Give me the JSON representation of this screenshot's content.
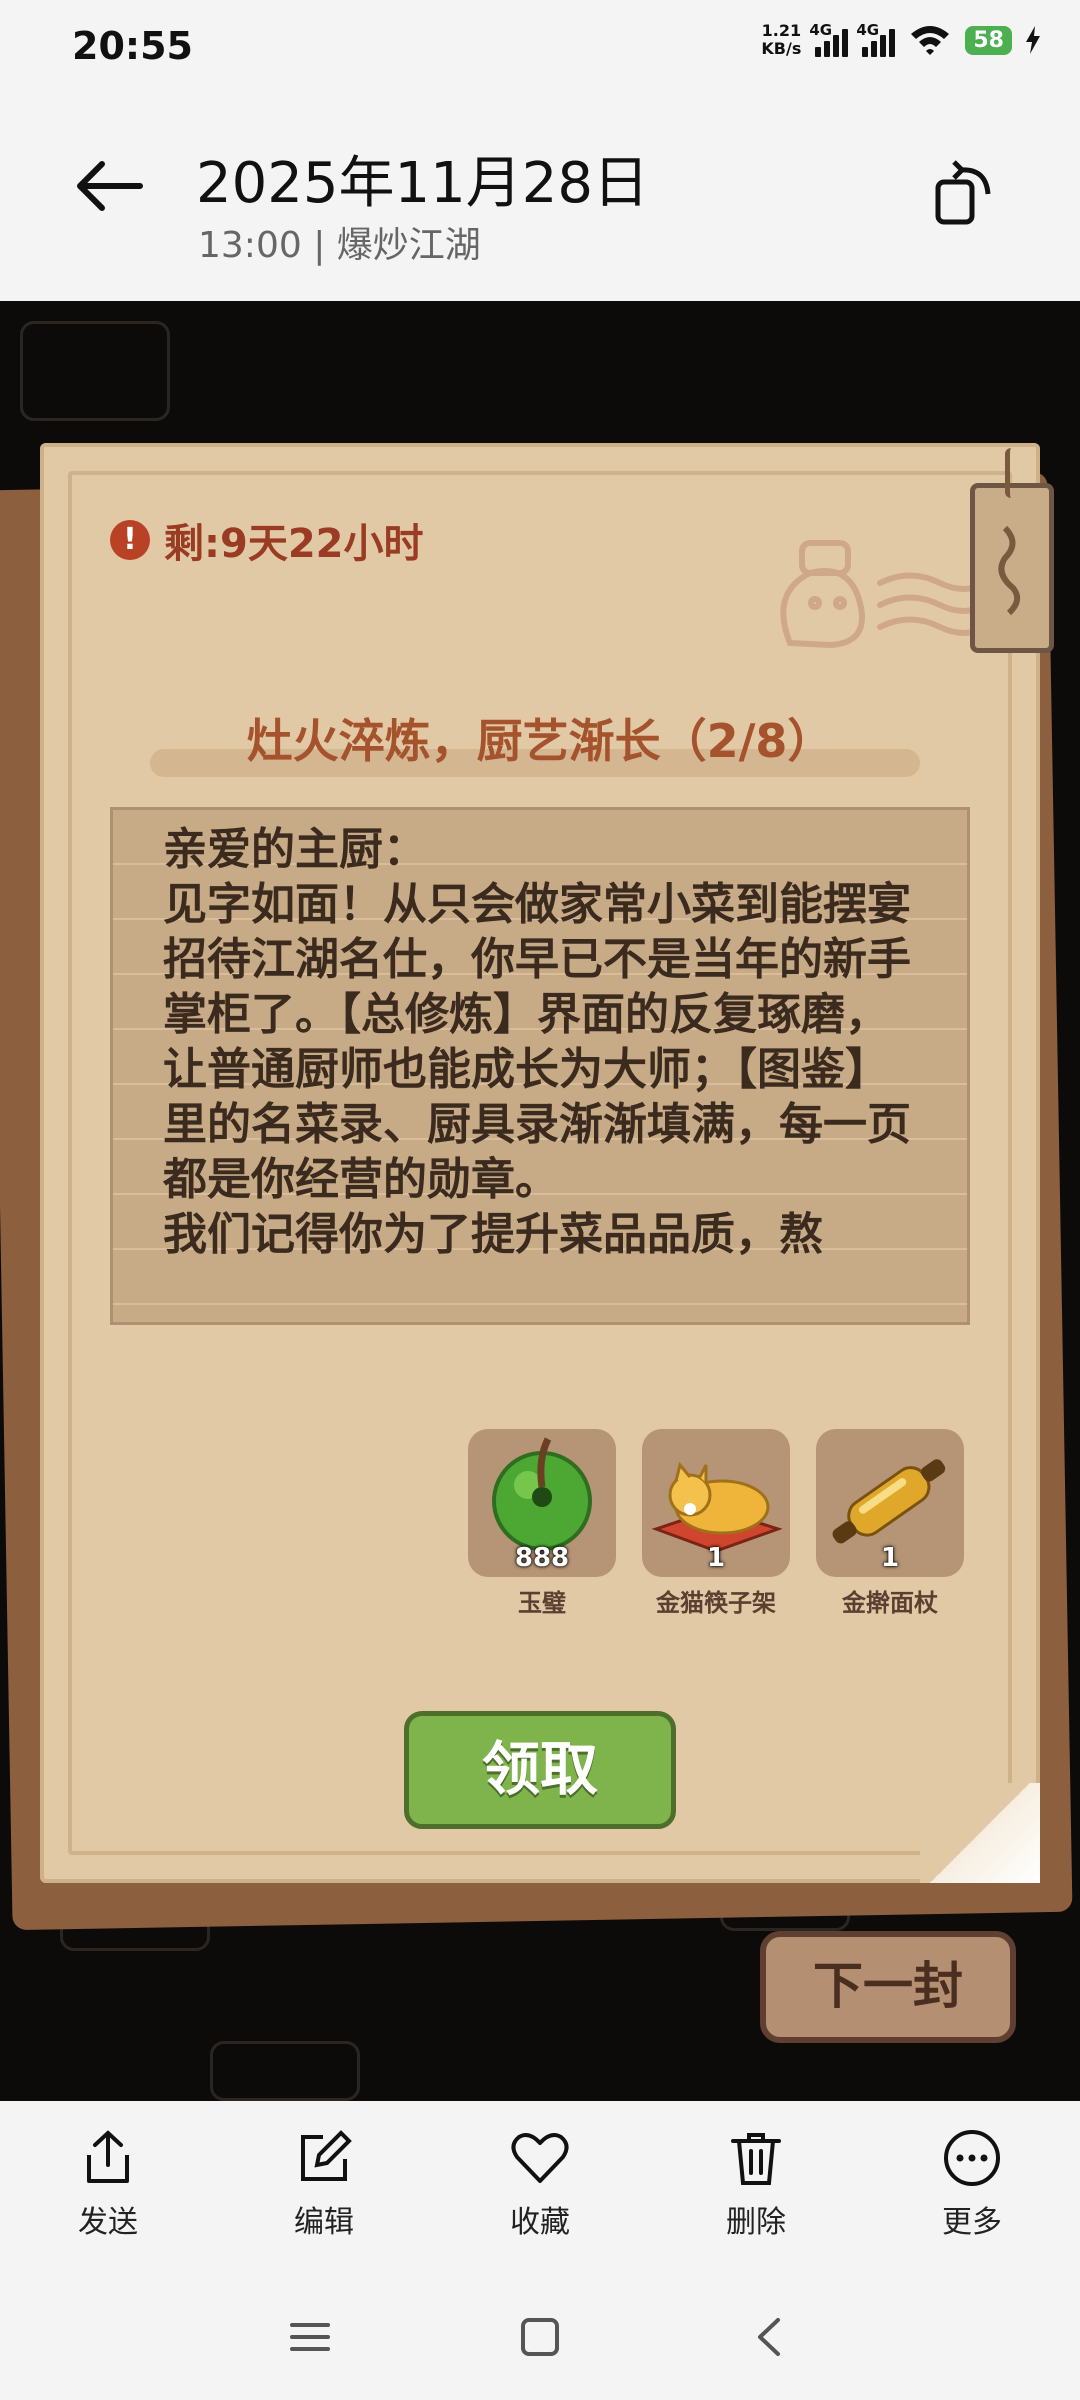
{
  "status_bar": {
    "time": "20:55",
    "net_speed_top": "1.21",
    "net_speed_bottom": "KB/s",
    "signal1": "4G",
    "signal2": "4G",
    "battery": "58"
  },
  "header": {
    "title": "2025年11月28日",
    "subtitle": "13:00 | 爆炒江湖"
  },
  "mail": {
    "timer": "剩:9天22小时",
    "title": "灶火淬炼，厨艺渐长（2/8）",
    "body": "亲爱的主厨：\n见字如面！从只会做家常小菜到能摆宴招待江湖名仕，你早已不是当年的新手掌柜了。【总修炼】界面的反复琢磨，让普通厨师也能成长为大师；【图鉴】里的名菜录、厨具录渐渐填满，每一页都是你经营的勋章。\n我们记得你为了提升菜品品质，熬",
    "rewards": [
      {
        "name": "玉璧",
        "qty": "888",
        "icon": "jade-disc-icon"
      },
      {
        "name": "金猫筷子架",
        "qty": "1",
        "icon": "golden-cat-icon"
      },
      {
        "name": "金擀面杖",
        "qty": "1",
        "icon": "rolling-pin-icon"
      }
    ],
    "claim_label": "领取",
    "next_label": "下一封"
  },
  "toolbar": {
    "items": [
      {
        "label": "发送",
        "icon": "share-icon"
      },
      {
        "label": "编辑",
        "icon": "edit-icon"
      },
      {
        "label": "收藏",
        "icon": "heart-icon"
      },
      {
        "label": "删除",
        "icon": "trash-icon"
      },
      {
        "label": "更多",
        "icon": "more-icon"
      }
    ]
  },
  "colors": {
    "paper": "#e2c9a6",
    "accent_title": "#a4532d",
    "claim_button": "#7fb34c"
  }
}
